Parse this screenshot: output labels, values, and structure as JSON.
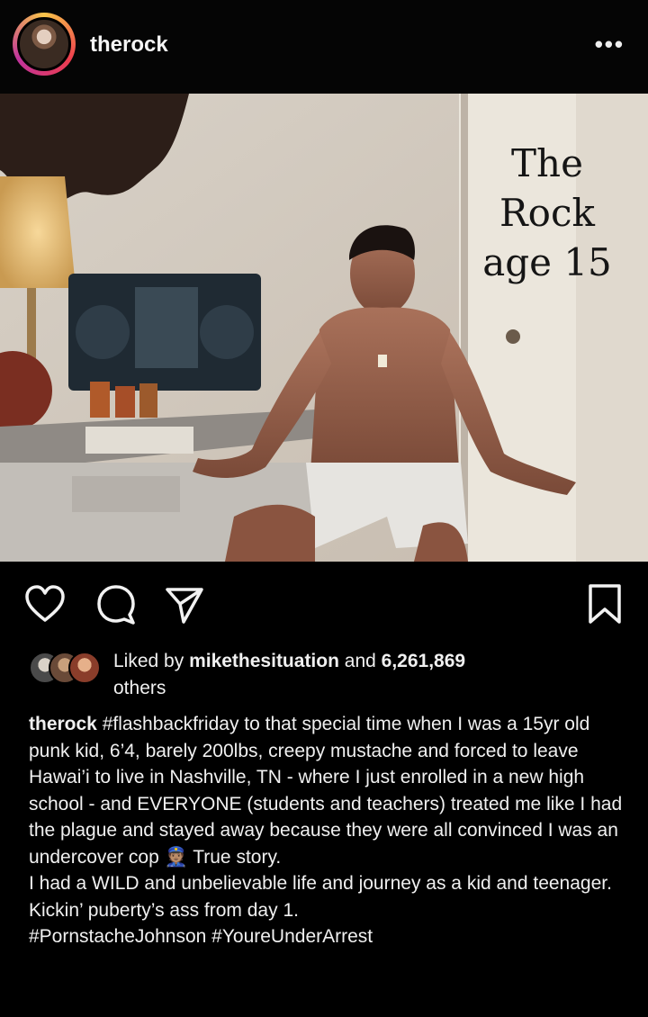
{
  "header": {
    "username": "therock",
    "more_icon": "more-horizontal-icon"
  },
  "photo": {
    "caption_lines": [
      "The",
      "Rock",
      "age 15"
    ]
  },
  "actions": {
    "icons": [
      "heart-icon",
      "comment-icon",
      "share-icon",
      "bookmark-icon"
    ]
  },
  "likes": {
    "prefix": "Liked by ",
    "user": "mikethesituation",
    "middle": " and ",
    "count": "6,261,869",
    "suffix": "others"
  },
  "caption": {
    "username": "therock",
    "hashtag_1": "#flashbackfriday",
    "line_1": " to that special time when I was a 15yr old punk kid, 6’4, barely 200lbs, creepy mustache and forced to leave Hawai’i to live in Nashville, TN - where I just enrolled in a new high school - and EVERYONE (students and teachers) treated me like I had the plague and stayed away because they were all convinced I was an undercover cop ",
    "emoji": "👮🏽",
    "line_1_end": "  True story.",
    "line_2": "I had a WILD and unbelievable life and journey as a kid and teenager.",
    "line_3": "Kickin’ puberty’s ass from day 1.",
    "hashtags": "#PornstacheJohnson #YoureUnderArrest"
  },
  "colors": {
    "background": "#000000",
    "text": "#f0f0f0"
  }
}
